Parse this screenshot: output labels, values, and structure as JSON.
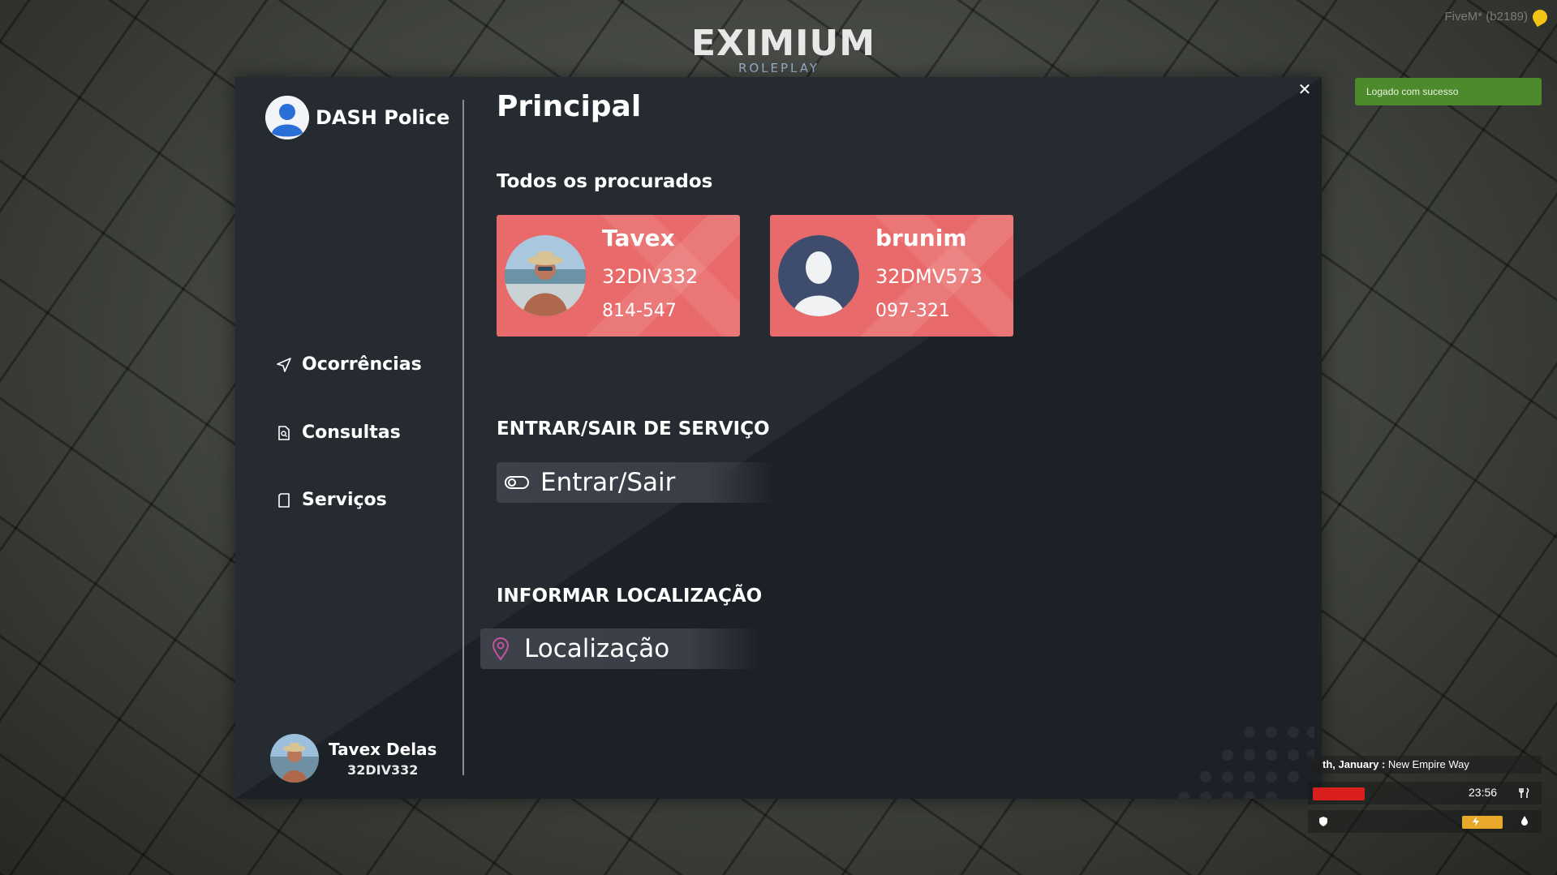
{
  "header": {
    "logo_main": "EXIMIUM",
    "logo_sub": "ROLEPLAY",
    "client_version": "FiveM* (b2189)"
  },
  "toast": {
    "message": "Logado com sucesso"
  },
  "sidebar": {
    "brand": "DASH Police",
    "items": [
      {
        "label": "Ocorrências",
        "icon": "send-icon"
      },
      {
        "label": "Consultas",
        "icon": "search-document-icon"
      },
      {
        "label": "Serviços",
        "icon": "document-icon"
      }
    ],
    "user": {
      "name": "Tavex Delas",
      "id": "32DIV332"
    }
  },
  "main": {
    "title": "Principal",
    "wanted_section_title": "Todos os procurados",
    "wanted": [
      {
        "name": "Tavex",
        "id": "32DIV332",
        "phone": "814-547",
        "photo": "beach-photo"
      },
      {
        "name": "brunim",
        "id": "32DMV573",
        "phone": "097-321",
        "photo": "default-avatar"
      }
    ],
    "duty_section_title": "ENTRAR/SAIR DE SERVIÇO",
    "duty_button": "Entrar/Sair",
    "location_section_title": "INFORMAR LOCALIZAÇÃO",
    "location_button": "Localização"
  },
  "hud": {
    "street_prefix": "th, January",
    "street_name": "New Empire Way",
    "time": "23:56",
    "health_level": 0.2,
    "stamina_level": 0.15,
    "colors": {
      "health": "#d91e1e",
      "stamina": "#e8a92a",
      "card": "#e86a6a",
      "accent": "#9fb7d6"
    }
  }
}
